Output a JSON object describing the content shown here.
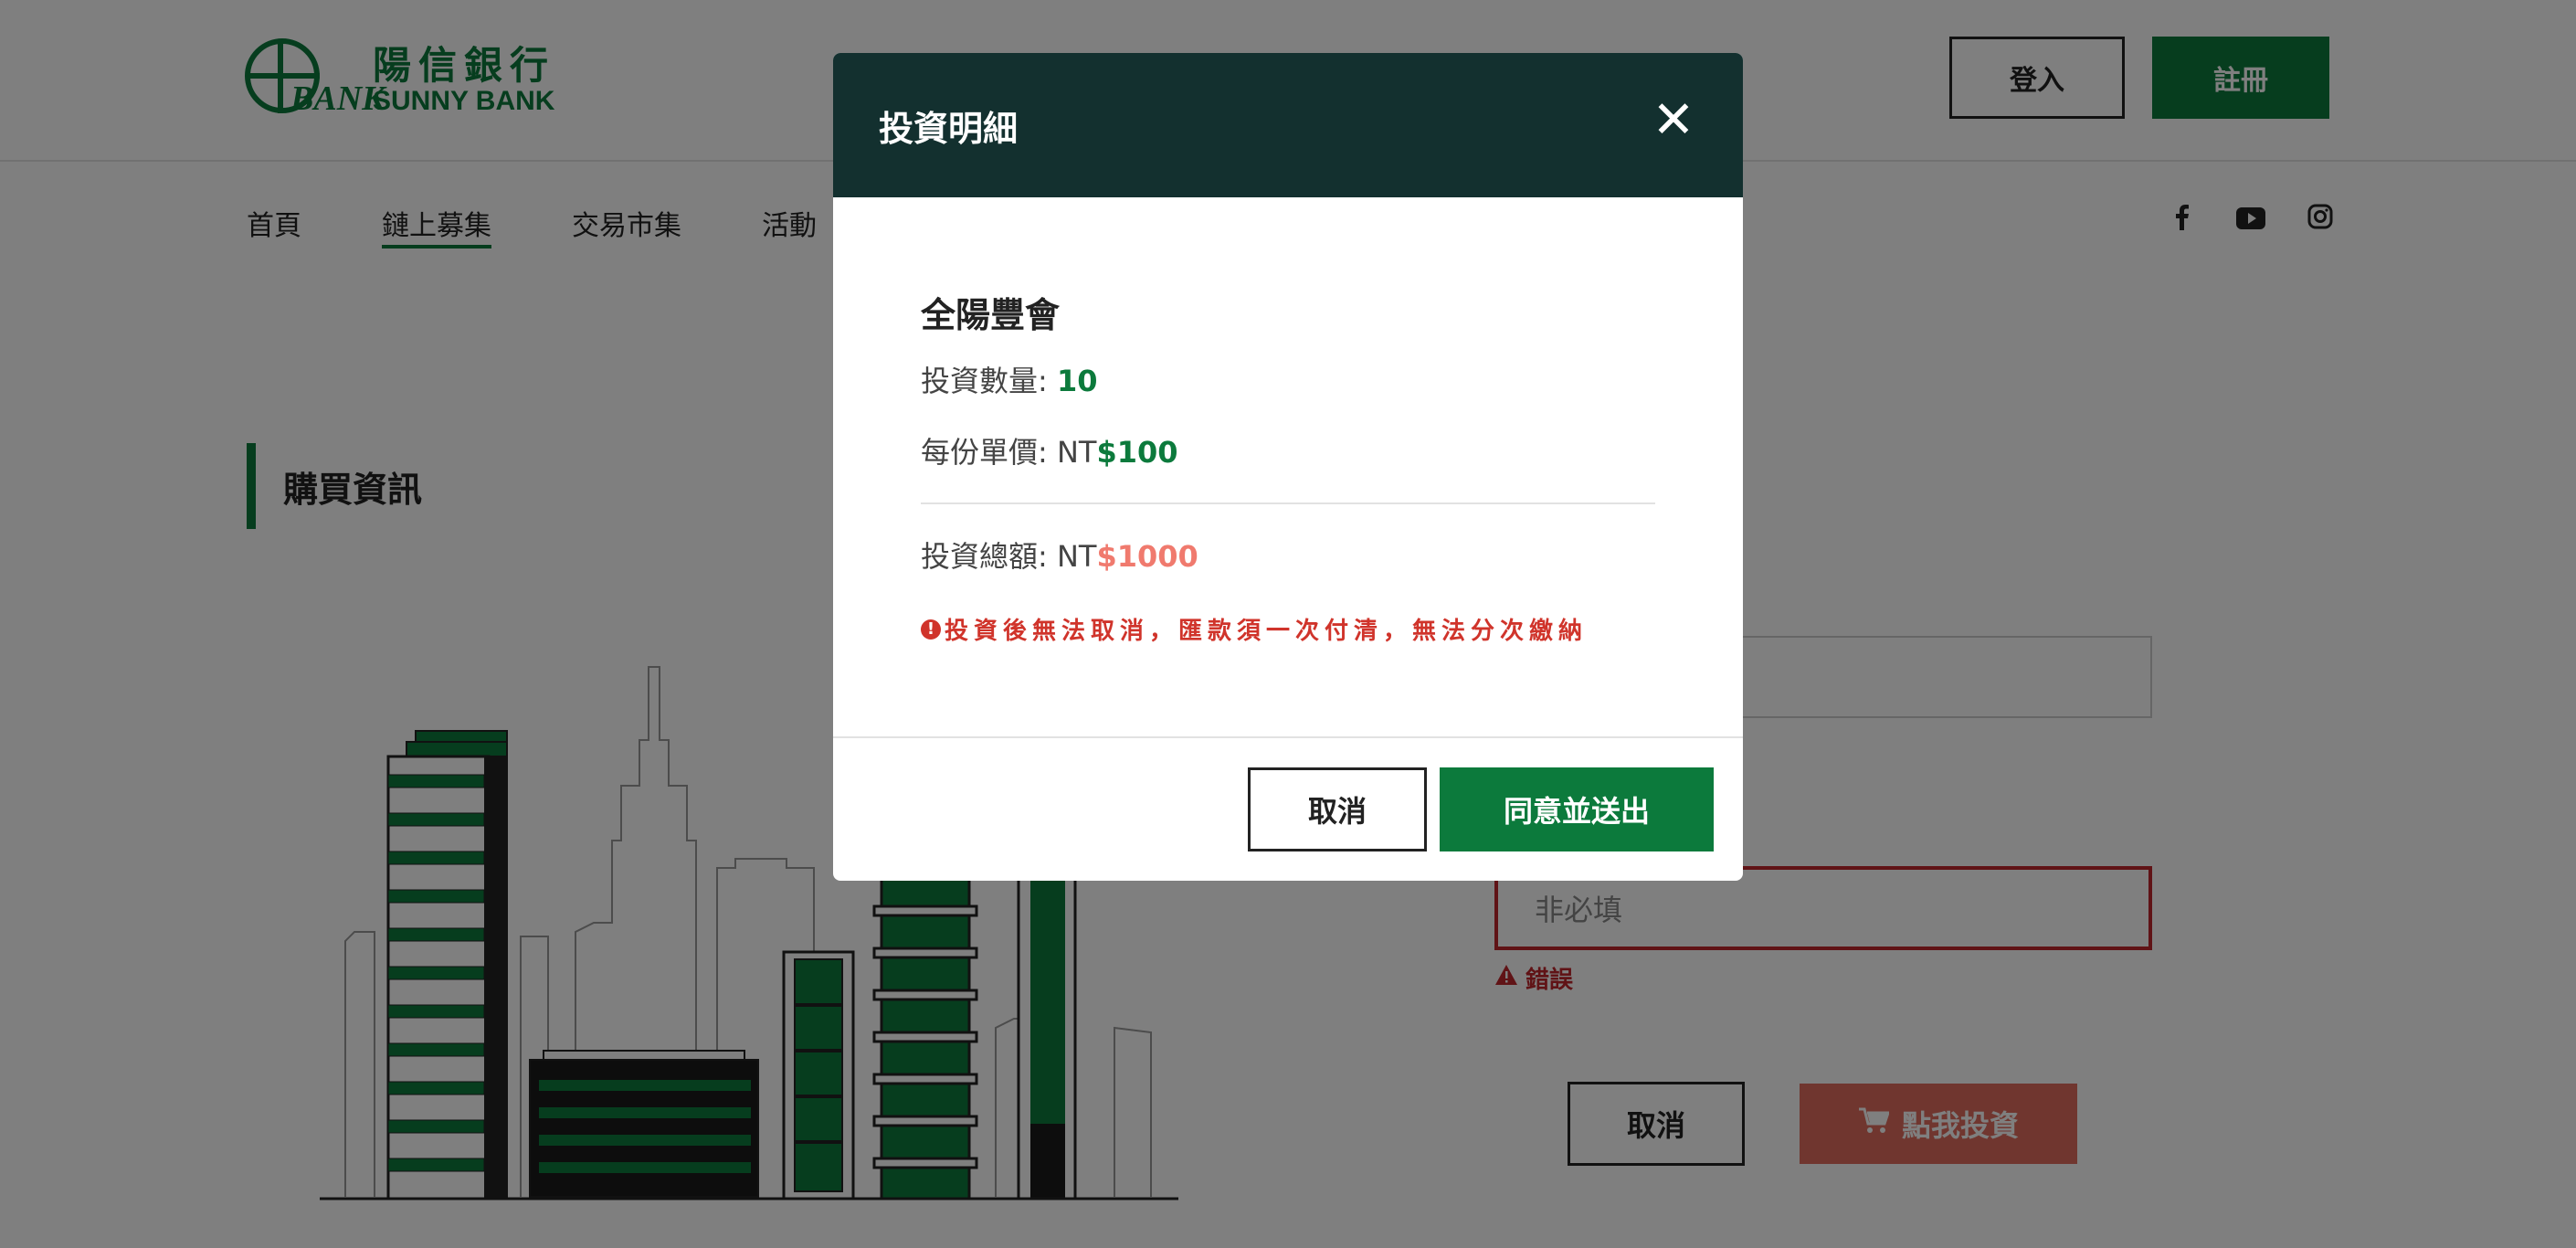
{
  "header": {
    "logo_text_cn": "陽信銀行",
    "logo_text_en": "SUNNY BANK",
    "logo_mark_text": "BANK",
    "login_label": "登入",
    "register_label": "註冊"
  },
  "nav": {
    "items": [
      {
        "label": "首頁"
      },
      {
        "label": "鏈上募集"
      },
      {
        "label": "交易市集"
      },
      {
        "label": "活動"
      }
    ],
    "social_icons": [
      "facebook-icon",
      "youtube-icon",
      "instagram-icon"
    ]
  },
  "section": {
    "title": "購買資訊"
  },
  "form": {
    "optional_placeholder": "非必填",
    "error_text": "錯誤",
    "cancel_label": "取消",
    "invest_label": "點我投資"
  },
  "modal": {
    "title": "投資明細",
    "item_name": "全陽豐會",
    "quantity_label": "投資數量: ",
    "quantity_value": "10",
    "unit_price_label": "每份單價: NT",
    "unit_price_value": "$100",
    "total_label": "投資總額: NT",
    "total_value": "$1000",
    "warning_text": "投資後無法取消，匯款須一次付清，無法分次繳納",
    "cancel_label": "取消",
    "submit_label": "同意並送出"
  },
  "colors": {
    "brand_green": "#0c7a3c",
    "modal_header": "#13302f",
    "error_red": "#d0342b",
    "total_salmon": "#f07a6e"
  }
}
